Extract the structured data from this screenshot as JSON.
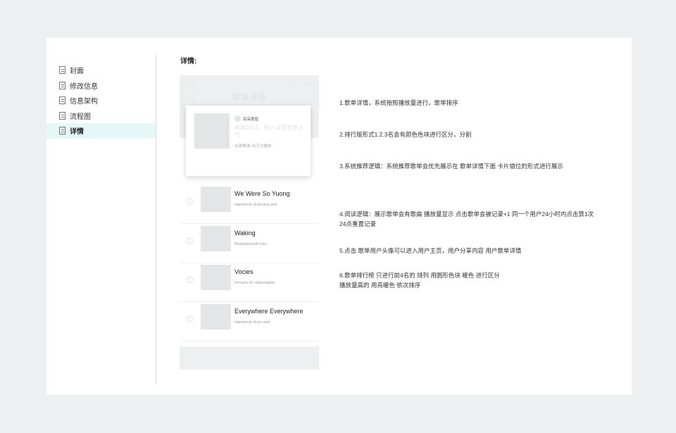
{
  "sidebar": {
    "items": [
      {
        "label": "封面",
        "active": false
      },
      {
        "label": "修改信息",
        "active": false
      },
      {
        "label": "信息架构",
        "active": false
      },
      {
        "label": "流程图",
        "active": false
      },
      {
        "label": "详情",
        "active": true
      }
    ]
  },
  "section_title": "详情:",
  "phone": {
    "status_time": "9:41",
    "status_right": "▪▪▪ ◠ ▬",
    "back_glyph": "〈",
    "title": "歌单详情",
    "more_glyph": "···",
    "card": {
      "username": "耳朵爱妞",
      "description": "新歌2019，给入深漫浪里大气",
      "stats": "25首歌曲    46万次播放"
    },
    "songs": [
      {
        "rank": "1",
        "name": "We Were So Yuong",
        "artist": "Hammock–Everying and"
      },
      {
        "rank": "2",
        "name": "Waking",
        "artist": "Maybeshewill–Fair"
      },
      {
        "rank": "3",
        "name": "Vocies",
        "artist": "Immanu El–Hibernation"
      },
      {
        "rank": "4",
        "name": "Everywhere Everywhere",
        "artist": "Hammock–Ever and"
      }
    ]
  },
  "notes": [
    {
      "lines": [
        "1.歌单详情，系统按照播放量进行，歌单排序"
      ]
    },
    {
      "lines": [
        "2.排行版形式1.2.3名会有颜色色块进行区分，分割"
      ]
    },
    {
      "lines": [
        "3.系统推荐逻辑：系统推荐歌单会优先展示在 歌单详情下面 卡片错位的形式进行展示"
      ]
    },
    {
      "lines": [
        "4.阅读逻辑：展示歌单会有歌曲 播放量显示  点击歌单会被记录+1 同一个用户24小时内点击算1次",
        "24点重置记录"
      ]
    },
    {
      "lines": [
        "5.点击 歌单用户头像可以进入用户主页，用户分享内容 用户歌单详情"
      ]
    },
    {
      "lines": [
        "6.歌单排行榜 只进行前4名的 排列 用圆形色块 暖色 进行区分",
        "播放量高的 用亮暖色  依次排序"
      ]
    }
  ]
}
